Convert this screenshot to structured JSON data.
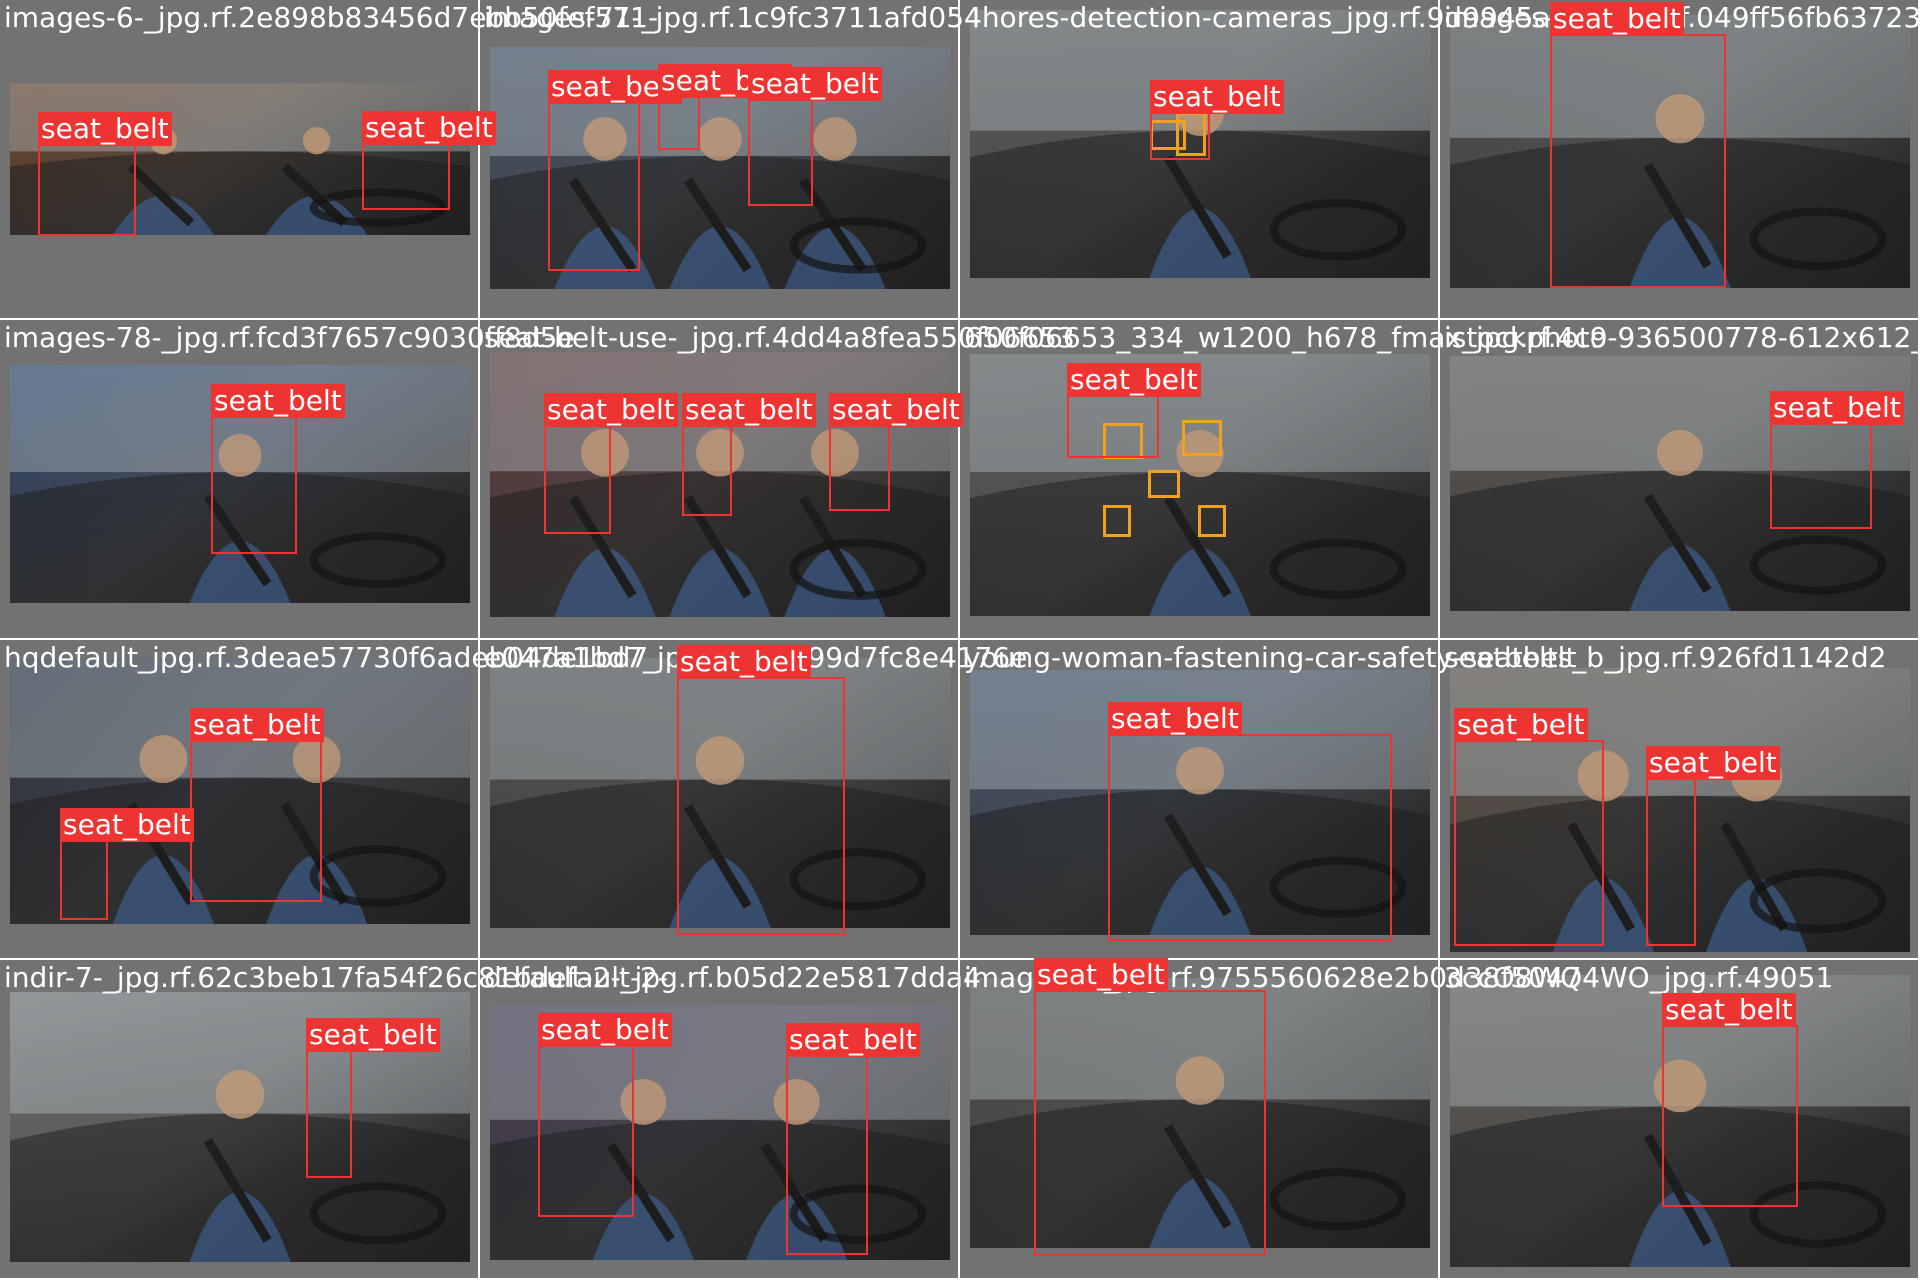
{
  "tiles": [
    {
      "title": "images-6-_jpg.rf.2e898b83456d7ebb50fef571-",
      "boxes": [
        {
          "label": "seat_belt"
        },
        {
          "label": "seat_belt"
        }
      ]
    },
    {
      "title": "images-71-_jpg.rf.1c9fc3711afd054",
      "boxes": [
        {
          "label": "seat_belt"
        },
        {
          "label": "seat_belt"
        },
        {
          "label": "seat_belt"
        }
      ]
    },
    {
      "title": "4hores-detection-cameras_jpg.rf.9d9945ae",
      "boxes": [
        {
          "label": "seat_belt"
        }
      ]
    },
    {
      "title": "images-10-_jpg.rf.049ff56fb637238",
      "boxes": [
        {
          "label": "seat_belt"
        }
      ]
    },
    {
      "title": "images-78-_jpg.rf.fcd3f7657c9030ff8d5e",
      "boxes": [
        {
          "label": "seat_belt"
        }
      ]
    },
    {
      "title": "seat-belt-use-_jpg.rf.4dd4a8fea550f06653",
      "boxes": [
        {
          "label": "seat_belt"
        },
        {
          "label": "seat_belt"
        },
        {
          "label": "seat_belt"
        }
      ]
    },
    {
      "title": "650f06653_334_w1200_h678_fmax_jpg.rf.4c9",
      "boxes": [
        {
          "label": "seat_belt"
        }
      ]
    },
    {
      "title": "istockphoto-936500778-612x612_",
      "boxes": [
        {
          "label": "seat_belt"
        }
      ]
    },
    {
      "title": "hqdefault_jpg.rf.3deae57730f6adeb04de1bd7",
      "boxes": [
        {
          "label": "seat_belt"
        },
        {
          "label": "seat_belt"
        }
      ]
    },
    {
      "title": "e047a1bd7_jpg.rf.5ea399d7fc8e4176e",
      "boxes": [
        {
          "label": "seat_belt"
        }
      ]
    },
    {
      "title": "young-woman-fastening-car-safety-seatbelt",
      "boxes": [
        {
          "label": "seat_belt"
        }
      ]
    },
    {
      "title": "seatbelts_b_jpg.rf.926fd1142d2",
      "boxes": [
        {
          "label": "seat_belt"
        },
        {
          "label": "seat_belt"
        }
      ]
    },
    {
      "title": "indir-7-_jpg.rf.62c3beb17fa54f26c81bdefault-2-",
      "boxes": [
        {
          "label": "seat_belt"
        }
      ]
    },
    {
      "title": "default-2-_jpg.rf.b05d22e5817dda4",
      "boxes": [
        {
          "label": "seat_belt"
        },
        {
          "label": "seat_belt"
        }
      ]
    },
    {
      "title": "images-8-_jpg.rf.9755560628e2b0d38f5047",
      "boxes": [
        {
          "label": "seat_belt"
        }
      ]
    },
    {
      "title": "3ccO8WQ4WO_jpg.rf.49051",
      "boxes": [
        {
          "label": "seat_belt"
        }
      ]
    }
  ],
  "colors": {
    "box": "#ee3333",
    "label_text": "#ffffff",
    "tile_bg": "#727272",
    "camera_frame": "#f2a020"
  }
}
